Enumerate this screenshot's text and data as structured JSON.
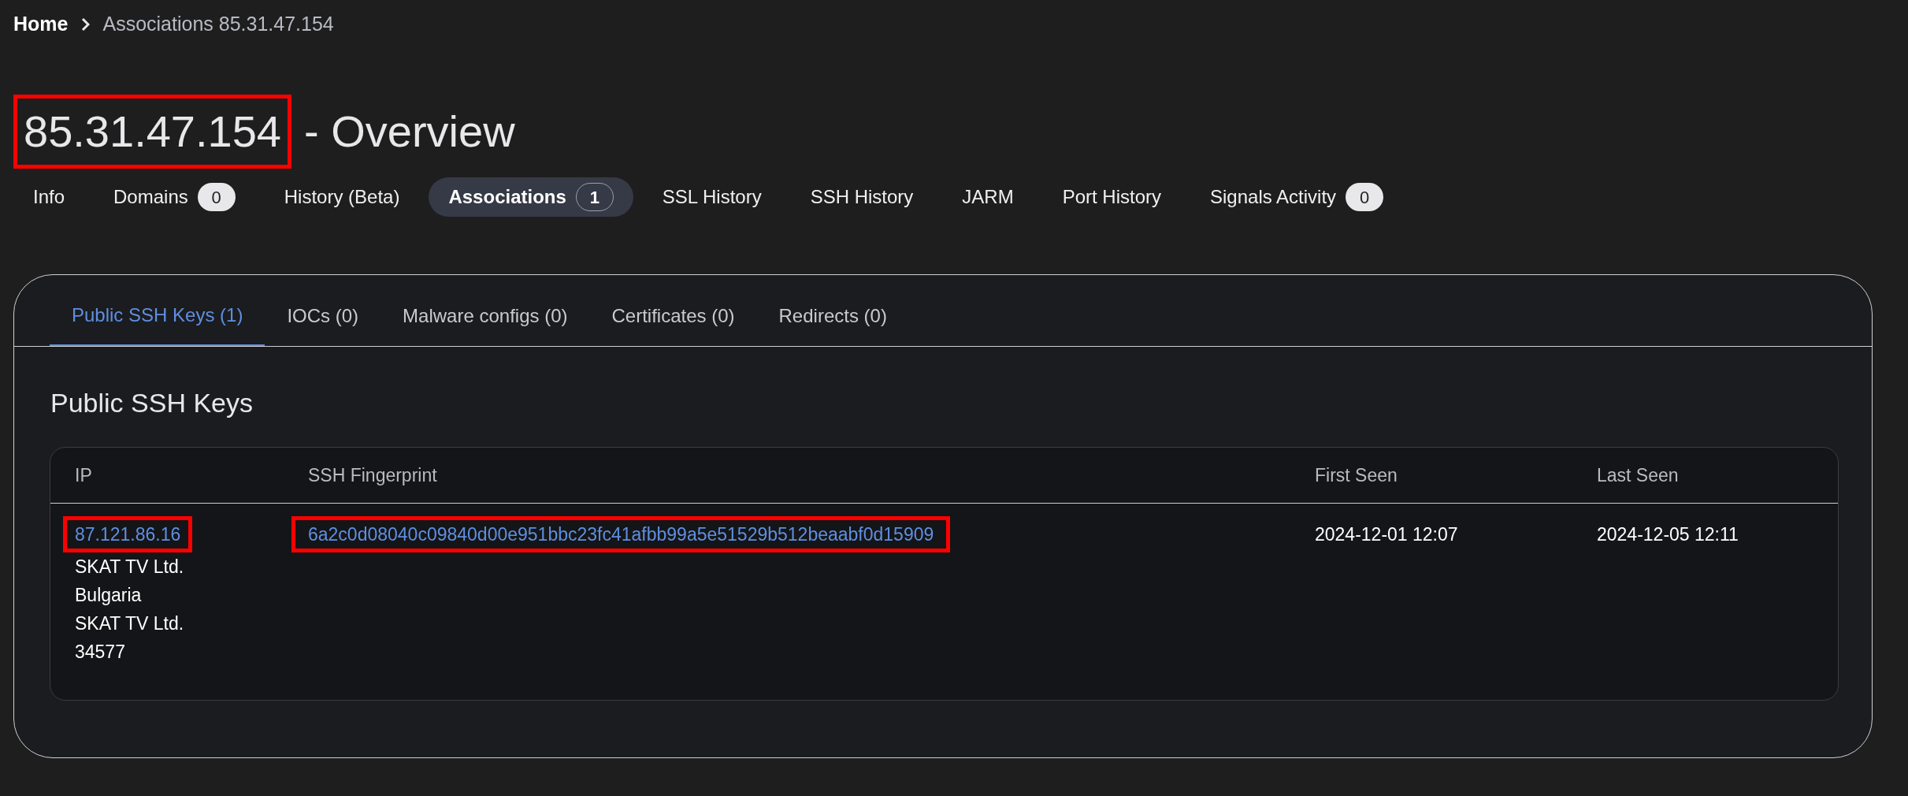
{
  "breadcrumb": [
    {
      "label": "Home",
      "current": false
    },
    {
      "label": "Associations 85.31.47.154",
      "current": true
    }
  ],
  "title": {
    "ip": "85.31.47.154",
    "ip_highlighted": true,
    "suffix": "- Overview"
  },
  "tabs": [
    {
      "label": "Info",
      "selected": false
    },
    {
      "label": "Domains",
      "count": "0",
      "selected": false
    },
    {
      "label": "History (Beta)",
      "selected": false
    },
    {
      "label": "Associations",
      "count": "1",
      "selected": true
    },
    {
      "label": "SSL History",
      "selected": false
    },
    {
      "label": "SSH History",
      "selected": false
    },
    {
      "label": "JARM",
      "selected": false
    },
    {
      "label": "Port History",
      "selected": false
    },
    {
      "label": "Signals Activity",
      "count": "0",
      "selected": false
    }
  ],
  "subtabs": [
    {
      "label": "Public SSH Keys (1)",
      "selected": true
    },
    {
      "label": "IOCs (0)",
      "selected": false
    },
    {
      "label": "Malware configs (0)",
      "selected": false
    },
    {
      "label": "Certificates (0)",
      "selected": false
    },
    {
      "label": "Redirects (0)",
      "selected": false
    }
  ],
  "section_title": "Public SSH Keys",
  "table": {
    "columns": [
      "IP",
      "SSH Fingerprint",
      "First Seen",
      "Last Seen"
    ],
    "rows": [
      {
        "ip": "87.121.86.16",
        "ip_highlighted": true,
        "ip_details": [
          "SKAT TV Ltd.",
          "Bulgaria",
          "SKAT TV Ltd.",
          "34577"
        ],
        "fingerprint": "6a2c0d08040c09840d00e951bbc23fc41afbb99a5e51529b512beaabf0d15909",
        "fingerprint_highlighted": true,
        "first_seen": "2024-12-01 12:07",
        "last_seen": "2024-12-05 12:11"
      }
    ]
  }
}
